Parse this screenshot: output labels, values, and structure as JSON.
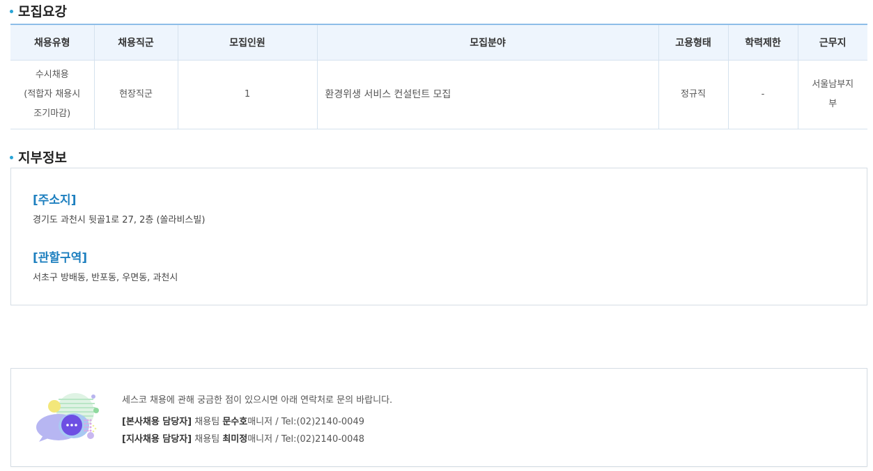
{
  "recruit_section": {
    "title": "모집요강",
    "headers": [
      "채용유형",
      "채용직군",
      "모집인원",
      "모집분야",
      "고용형태",
      "학력제한",
      "근무지"
    ],
    "row": {
      "type_lines": [
        "수시채용",
        "(적합자 채용시",
        "조기마감)"
      ],
      "job_group": "현장직군",
      "headcount": "1",
      "field": "환경위생 서비스 컨설턴트 모집",
      "employment": "정규직",
      "education": "-",
      "location_lines": [
        "서울남부지",
        "부"
      ]
    }
  },
  "branch_section": {
    "title": "지부정보",
    "address_label": "[주소지]",
    "address": "경기도 과천시 뒷골1로 27, 2층 (쏠라비스빌)",
    "area_label": "[관할구역]",
    "area": "서초구 방배동, 반포동, 우면동, 과천시"
  },
  "contact": {
    "intro": "세스코 채용에 관해 궁금한 점이 있으시면 아래 연락처로 문의 바랍니다.",
    "hq": {
      "label": "[본사채용 담당자]",
      "team": "채용팀",
      "name": "문수호",
      "title": "매니저 / Tel:(02)2140-0049"
    },
    "branch": {
      "label": "[지사채용 담당자]",
      "team": "채용팀",
      "name": "최미정",
      "title": "매니저 / Tel:(02)2140-0048"
    }
  },
  "colors": {
    "accent": "#29a4d6",
    "label_blue": "#1d7fbf",
    "header_bg": "#eef5fd",
    "header_border": "#8dbde8"
  },
  "icons": {
    "contact": "chat-bubbles-icon"
  }
}
